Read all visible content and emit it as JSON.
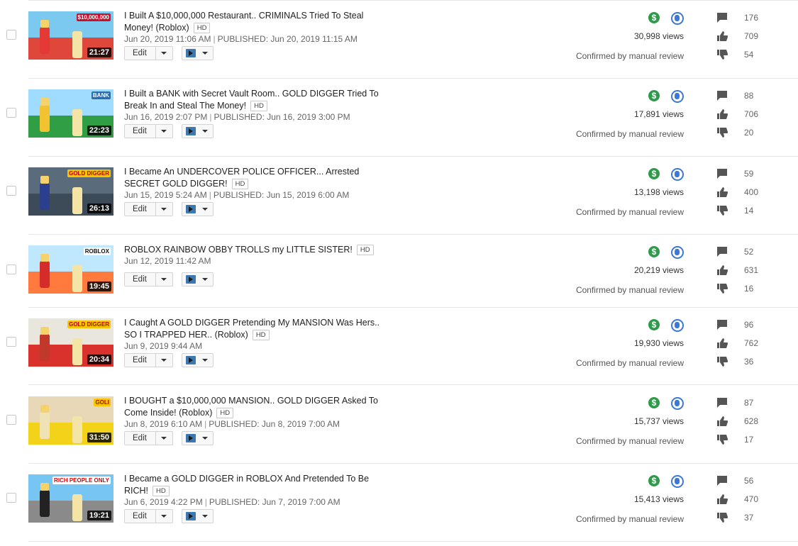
{
  "list": {
    "review_label": "Confirmed by manual review",
    "edit_label": "Edit",
    "hd_label": "HD",
    "videos": [
      {
        "title": "I Built A $10,000,000 Restaurant.. CRIMINALS Tried To Steal Money! (Roblox)",
        "date": "Jun 20, 2019 11:06 AM",
        "published": "PUBLISHED: Jun 20, 2019 11:15 AM",
        "duration": "21:27",
        "views": "30,998 views",
        "comments": "176",
        "likes": "709",
        "dislikes": "54",
        "thumb_text": "$10,000,000"
      },
      {
        "title": "I Built a BANK with Secret Vault Room.. GOLD DIGGER Tried To Break In and Steal The Money!",
        "date": "Jun 16, 2019 2:07 PM",
        "published": "PUBLISHED: Jun 16, 2019 3:00 PM",
        "duration": "22:23",
        "views": "17,891 views",
        "comments": "88",
        "likes": "706",
        "dislikes": "20",
        "thumb_text": "BANK"
      },
      {
        "title": "I Became An UNDERCOVER POLICE OFFICER... Arrested SECRET GOLD DIGGER!",
        "date": "Jun 15, 2019 5:24 AM",
        "published": "PUBLISHED: Jun 15, 2019 6:00 AM",
        "duration": "26:13",
        "views": "13,198 views",
        "comments": "59",
        "likes": "400",
        "dislikes": "14",
        "thumb_text": "GOLD DIGGER"
      },
      {
        "title": "ROBLOX RAINBOW OBBY TROLLS my LITTLE SISTER!",
        "date": "Jun 12, 2019 11:42 AM",
        "published": "",
        "duration": "19:45",
        "views": "20,219 views",
        "comments": "52",
        "likes": "631",
        "dislikes": "16",
        "thumb_text": "ROBLOX"
      },
      {
        "title": "I Caught A GOLD DIGGER Pretending My MANSION Was Hers.. SO I TRAPPED HER.. (Roblox)",
        "date": "Jun 9, 2019 9:44 AM",
        "published": "",
        "duration": "20:34",
        "views": "19,930 views",
        "comments": "96",
        "likes": "762",
        "dislikes": "36",
        "thumb_text": "GOLD DIGGER"
      },
      {
        "title": "I BOUGHT a $10,000,000 MANSION.. GOLD DIGGER Asked To Come Inside! (Roblox)",
        "date": "Jun 8, 2019 6:10 AM",
        "published": "PUBLISHED: Jun 8, 2019 7:00 AM",
        "duration": "31:50",
        "views": "15,737 views",
        "comments": "87",
        "likes": "628",
        "dislikes": "17",
        "thumb_text": "GOLI"
      },
      {
        "title": "I Became a GOLD DIGGER in ROBLOX And Pretended To Be RICH!",
        "date": "Jun 6, 2019 4:22 PM",
        "published": "PUBLISHED: Jun 7, 2019 7:00 AM",
        "duration": "19:21",
        "views": "15,413 views",
        "comments": "56",
        "likes": "470",
        "dislikes": "37",
        "thumb_text": "RICH PEOPLE ONLY"
      }
    ]
  },
  "colors": {
    "monetization": "#2e9a4a",
    "visibility": "#3b78d8",
    "promote": "#3b78b4"
  }
}
